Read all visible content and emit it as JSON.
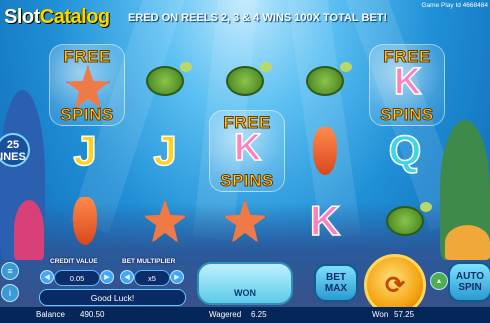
{
  "header": {
    "logo_prefix": "Slot",
    "logo_suffix": "Catalog",
    "marquee": "ERED ON REELS 2, 3 & 4 WINS 100X TOTAL BET!",
    "game_play_id": "Game Play Id 4668484"
  },
  "reels": {
    "free_label": "FREE",
    "spins_label": "SPINS",
    "letters": {
      "j1": "J",
      "j2": "J",
      "k_center": "K",
      "k_right_top": "K",
      "q": "Q",
      "k_bottom": "K"
    },
    "colors": {
      "j": "#ffd21f",
      "k": "#ff7fc4",
      "q": "#3fd5e8"
    }
  },
  "lines": {
    "count": "25",
    "label": "INES"
  },
  "controls": {
    "credit_value_label": "CREDIT VALUE",
    "credit_value": "0.05",
    "bet_multiplier_label": "BET MULTIPLIER",
    "bet_multiplier": "x5",
    "message": "Good Luck!",
    "won_label": "WON",
    "bet_max_label": "BET MAX",
    "auto_spin_label": "AUTO SPIN"
  },
  "status": {
    "balance_label": "Balance",
    "balance_value": "490.50",
    "wagered_label": "Wagered",
    "wagered_value": "6.25",
    "won_label": "Won",
    "won_value": "57.25"
  }
}
